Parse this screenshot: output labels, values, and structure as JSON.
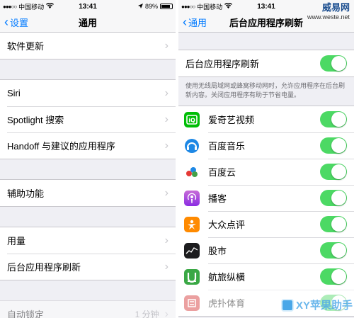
{
  "status": {
    "carrier": "中国移动",
    "time": "13:41",
    "battery": "89%",
    "battery_level": 0.89
  },
  "left": {
    "back_label": "设置",
    "title": "通用",
    "rows": {
      "software_update": "软件更新",
      "siri": "Siri",
      "spotlight": "Spotlight 搜索",
      "handoff": "Handoff 与建议的应用程序",
      "accessibility": "辅助功能",
      "usage": "用量",
      "bg_refresh": "后台应用程序刷新",
      "auto_lock": "自动锁定",
      "auto_lock_value": "1 分钟"
    }
  },
  "right": {
    "back_label": "通用",
    "title": "后台应用程序刷新",
    "master_label": "后台应用程序刷新",
    "master_on": true,
    "footnote": "使用无线局域网或蜂窝移动网时，允许应用程序在后台刷新内容。关闭应用程序有助于节省电量。",
    "apps": [
      {
        "name": "爱奇艺视频",
        "icon": "iqiyi-icon",
        "on": true
      },
      {
        "name": "百度音乐",
        "icon": "baidu-music-icon",
        "on": true
      },
      {
        "name": "百度云",
        "icon": "baidu-cloud-icon",
        "on": true
      },
      {
        "name": "播客",
        "icon": "podcasts-icon",
        "on": true
      },
      {
        "name": "大众点评",
        "icon": "dianping-icon",
        "on": true
      },
      {
        "name": "股市",
        "icon": "stocks-icon",
        "on": true
      },
      {
        "name": "航旅纵横",
        "icon": "umetrip-icon",
        "on": true
      },
      {
        "name": "虎扑体育",
        "icon": "hupu-icon",
        "on": true
      }
    ]
  },
  "watermarks": {
    "top_logo": "威易网",
    "top_url": "www.weste.net",
    "bottom_text": "XY苹果助手"
  },
  "colors": {
    "ios_blue": "#007aff",
    "toggle_green": "#4cd964",
    "group_bg": "#efeff4"
  }
}
